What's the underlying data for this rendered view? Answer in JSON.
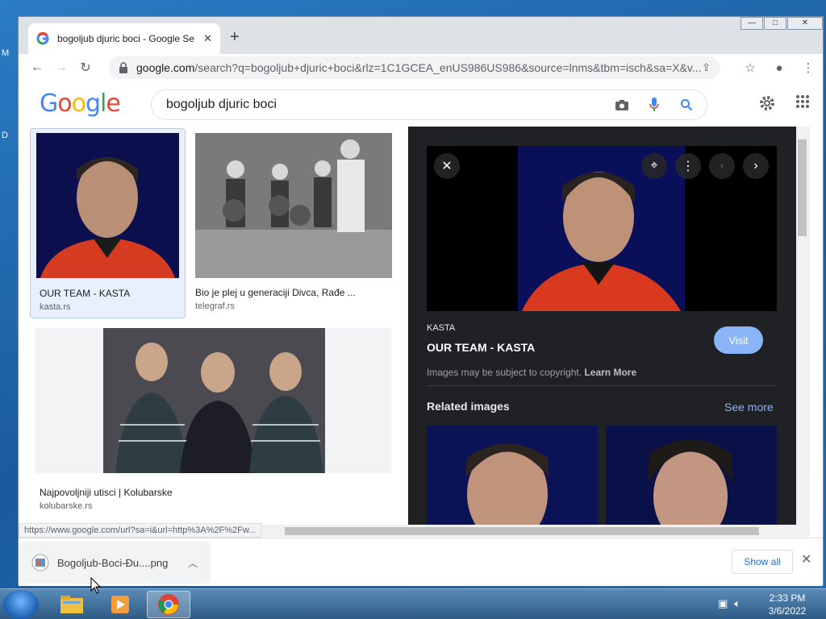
{
  "desktop": {
    "letters": [
      "M",
      "D"
    ]
  },
  "tab": {
    "title": "bogoljub djuric boci - Google Se",
    "close": "✕",
    "new_tab": "+"
  },
  "window_controls": {
    "minimize": "—",
    "maximize": "□",
    "close": "✕"
  },
  "omnibox": {
    "url_host": "google.com",
    "url_rest": "/search?q=bogoljub+djuric+boci&rlz=1C1GCEA_enUS986US986&source=lnms&tbm=isch&sa=X&v..."
  },
  "search": {
    "query": "bogoljub djuric boci"
  },
  "results": [
    {
      "caption": "OUR TEAM - KASTA",
      "source": "kasta.rs",
      "selected": true
    },
    {
      "caption": "Bio je plej u generaciji Divca, Rađe ...",
      "source": "telegraf.rs",
      "selected": false
    },
    {
      "caption": "Najpovoljniji utisci | Kolubarske",
      "source": "kolubarske.rs",
      "selected": false
    }
  ],
  "preview": {
    "site": "KASTA",
    "title": "OUR TEAM - KASTA",
    "visit_label": "Visit",
    "copyright_text": "Images may be subject to copyright.",
    "learn_more": "Learn More",
    "related_heading": "Related images",
    "see_more": "See more"
  },
  "status_url": "https://www.google.com/url?sa=i&url=http%3A%2F%2Fw...",
  "download": {
    "filename": "Bogoljub-Boci-Đu....png",
    "show_all": "Show all",
    "close": "✕"
  },
  "taskbar": {
    "time": "2:33 PM",
    "date": "3/6/2022"
  },
  "colors": {
    "google_blue": "#4285f4",
    "google_red": "#ea4335",
    "google_yellow": "#fbbc05",
    "google_green": "#34a853",
    "panel_bg": "#202124",
    "link_blue": "#8ab4f8"
  }
}
